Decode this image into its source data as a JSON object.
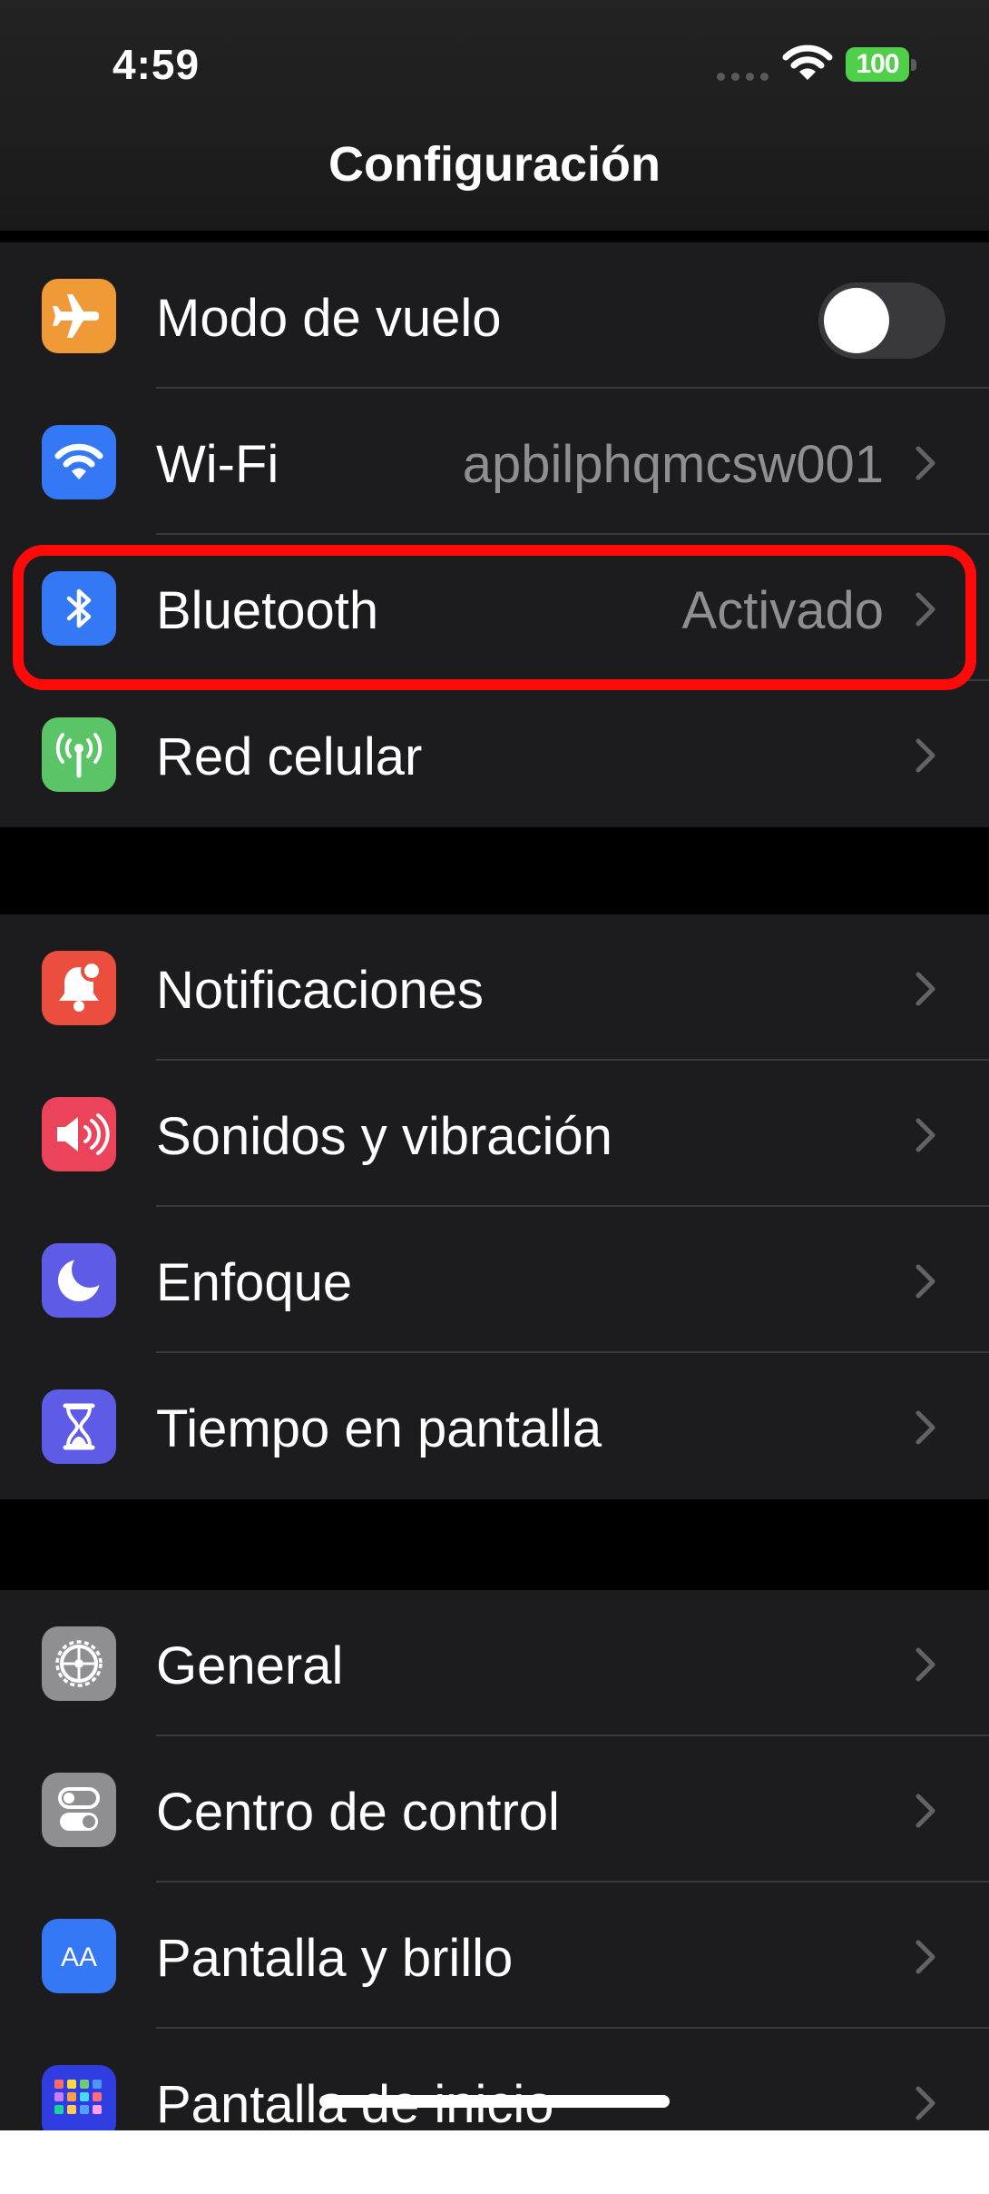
{
  "status_bar": {
    "time": "4:59",
    "battery": "100"
  },
  "header": {
    "title": "Configuración"
  },
  "groups": [
    {
      "rows": [
        {
          "label": "Modo de vuelo",
          "icon": "airplane-icon",
          "color": "#f09a37",
          "control": "toggle",
          "toggle_on": false
        },
        {
          "label": "Wi-Fi",
          "value": "apbilphqmcsw001",
          "icon": "wifi-icon",
          "color": "#3478f6"
        },
        {
          "label": "Bluetooth",
          "value": "Activado",
          "icon": "bluetooth-icon",
          "color": "#3478f6",
          "highlighted": true
        },
        {
          "label": "Red celular",
          "icon": "antenna-icon",
          "color": "#5ac467"
        }
      ]
    },
    {
      "rows": [
        {
          "label": "Notificaciones",
          "icon": "bell-icon",
          "color": "#eb4e3d"
        },
        {
          "label": "Sonidos y vibración",
          "icon": "speaker-icon",
          "color": "#eb445a"
        },
        {
          "label": "Enfoque",
          "icon": "moon-icon",
          "color": "#5e5ce6"
        },
        {
          "label": "Tiempo en pantalla",
          "icon": "hourglass-icon",
          "color": "#5e5ce6"
        }
      ]
    },
    {
      "rows": [
        {
          "label": "General",
          "icon": "gear-icon",
          "color": "#8e8e93"
        },
        {
          "label": "Centro de control",
          "icon": "switches-icon",
          "color": "#8e8e93"
        },
        {
          "label": "Pantalla y brillo",
          "icon": "text-size-icon",
          "color": "#3478f6",
          "icon_text": "AA"
        },
        {
          "label": "Pantalla de inicio",
          "icon": "home-grid-icon",
          "color": "#2e3ce0"
        }
      ]
    }
  ],
  "highlight_color": "#ff0a0a"
}
